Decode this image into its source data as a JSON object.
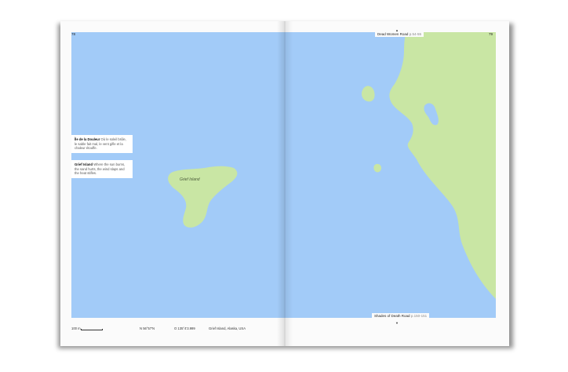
{
  "pages": {
    "left_number": "78",
    "right_number": "79"
  },
  "running_heads": {
    "top": {
      "title": "Dead Women Road",
      "ref": "p.54-55"
    },
    "bottom": {
      "title": "Shades of Death Road",
      "ref": "p.150-151"
    }
  },
  "notes": [
    {
      "title": "Île de la Douleur",
      "text": "Où le soleil brûle, le sable fait mal, le vent gifle et la chaleur étouffe."
    },
    {
      "title": "Grief Island",
      "text": "Where the sun burns, the sand hurts, the wind slaps and the heat stifles."
    }
  ],
  "map": {
    "island_label": "Grief Island",
    "colors": {
      "water": "#a2cbf8",
      "land": "#c9e6a4"
    }
  },
  "footer": {
    "scale": "100 m",
    "latitude": "N 56°57′N",
    "longitude": "O 135°4′3.999",
    "place": "Grief Island, Alaska, USA"
  }
}
